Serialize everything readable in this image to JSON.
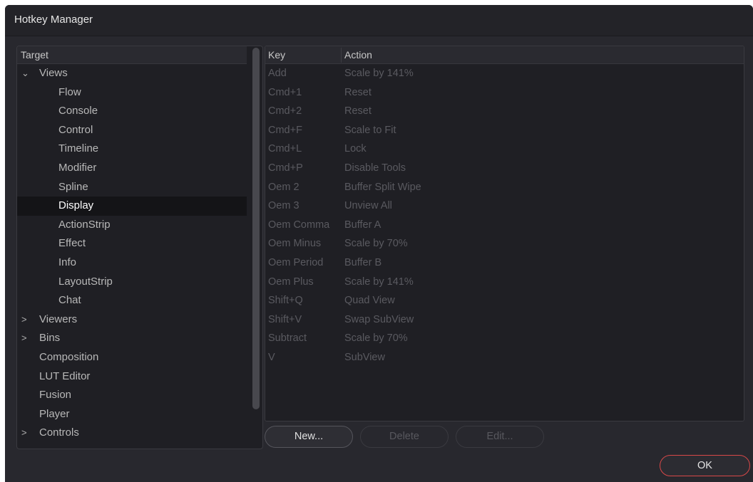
{
  "window": {
    "title": "Hotkey Manager"
  },
  "tree": {
    "header": "Target",
    "items": [
      {
        "label": "Views",
        "level": 0,
        "chevron": "⌄",
        "expanded": true
      },
      {
        "label": "Flow",
        "level": 1
      },
      {
        "label": "Console",
        "level": 1
      },
      {
        "label": "Control",
        "level": 1
      },
      {
        "label": "Timeline",
        "level": 1
      },
      {
        "label": "Modifier",
        "level": 1
      },
      {
        "label": "Spline",
        "level": 1
      },
      {
        "label": "Display",
        "level": 1,
        "selected": true
      },
      {
        "label": "ActionStrip",
        "level": 1
      },
      {
        "label": "Effect",
        "level": 1
      },
      {
        "label": "Info",
        "level": 1
      },
      {
        "label": "LayoutStrip",
        "level": 1
      },
      {
        "label": "Chat",
        "level": 1
      },
      {
        "label": "Viewers",
        "level": 0,
        "chevron": ">"
      },
      {
        "label": "Bins",
        "level": 0,
        "chevron": ">"
      },
      {
        "label": "Composition",
        "level": 0
      },
      {
        "label": "LUT Editor",
        "level": 0
      },
      {
        "label": "Fusion",
        "level": 0
      },
      {
        "label": "Player",
        "level": 0
      },
      {
        "label": "Controls",
        "level": 0,
        "chevron": ">"
      }
    ]
  },
  "list": {
    "columns": {
      "key": "Key",
      "action": "Action"
    },
    "rows": [
      {
        "key": "Add",
        "action": "Scale by 141%"
      },
      {
        "key": "Cmd+1",
        "action": "Reset"
      },
      {
        "key": "Cmd+2",
        "action": "Reset"
      },
      {
        "key": "Cmd+F",
        "action": "Scale to Fit"
      },
      {
        "key": "Cmd+L",
        "action": "Lock"
      },
      {
        "key": "Cmd+P",
        "action": "Disable Tools"
      },
      {
        "key": "Oem 2",
        "action": "Buffer Split Wipe"
      },
      {
        "key": "Oem 3",
        "action": "Unview All"
      },
      {
        "key": "Oem Comma",
        "action": "Buffer A"
      },
      {
        "key": "Oem Minus",
        "action": "Scale by 70%"
      },
      {
        "key": "Oem Period",
        "action": "Buffer B"
      },
      {
        "key": "Oem Plus",
        "action": "Scale by 141%"
      },
      {
        "key": "Shift+Q",
        "action": "Quad View"
      },
      {
        "key": "Shift+V",
        "action": "Swap SubView"
      },
      {
        "key": "Subtract",
        "action": "Scale by 70%"
      },
      {
        "key": "V",
        "action": "SubView"
      }
    ]
  },
  "buttons": {
    "new": "New...",
    "delete": "Delete",
    "edit": "Edit...",
    "ok": "OK"
  },
  "colors": {
    "accent_ok_border": "#d84848",
    "selected_row": "#141417"
  }
}
